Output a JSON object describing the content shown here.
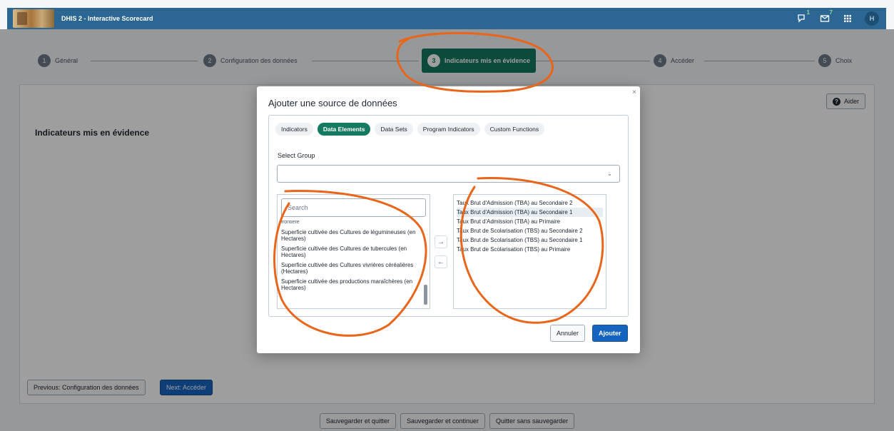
{
  "header": {
    "app_title": "DHIS 2 - Interactive Scorecard",
    "interpretations_badge": "1",
    "messages_badge": "7",
    "avatar_initial": "H"
  },
  "stepper": {
    "steps": [
      {
        "num": "1",
        "label": "Général"
      },
      {
        "num": "2",
        "label": "Configuration des données"
      },
      {
        "num": "3",
        "label": "Indicateurs mis en évidence"
      },
      {
        "num": "4",
        "label": "Accéder"
      },
      {
        "num": "5",
        "label": "Choix"
      }
    ],
    "active_step": 3
  },
  "main": {
    "heading": "Indicateurs mis en évidence",
    "help_label": "Aider",
    "prev_label": "Previous: Configuration des données",
    "next_label": "Next: Accéder"
  },
  "footer": {
    "save_quit": "Sauvegarder et quitter",
    "save_continue": "Sauvegarder et continuer",
    "quit_no_save": "Quitter sans sauvegarder"
  },
  "modal": {
    "close": "×",
    "title": "Ajouter une source de données",
    "tabs": [
      {
        "label": "Indicators",
        "active": false
      },
      {
        "label": "Data Elements",
        "active": true
      },
      {
        "label": "Data Sets",
        "active": false
      },
      {
        "label": "Program Indicators",
        "active": false
      },
      {
        "label": "Custom Functions",
        "active": false
      }
    ],
    "select_label": "Select Group",
    "select_value": "",
    "search_placeholder": "Search",
    "available": [
      "frontière",
      "Superficie cultivée des Cultures de légumineuses (en Hectares)",
      "Superficie cultivée des Cultures de tubercules (en Hectares)",
      "Superficie cultivée des Cultures vivrières céréalières (Hectares)",
      "Superficie cultivée des productions maraîchères (en Hectares)"
    ],
    "selected": [
      "Taux Brut d'Admission (TBA) au Secondaire 2",
      "Taux Brut d'Admission (TBA) au Secondaire 1",
      "Taux Brut d'Admission (TBA) au Primaire",
      "Taux Brut de Scolarisation (TBS) au Secondaire 2",
      "Taux Brut de Scolarisation (TBS) au Secondaire 1",
      "Taux Brut de Scolarisation (TBS) au Primaire"
    ],
    "highlighted_selected_index": 1,
    "transfer_right": "→",
    "transfer_left": "←",
    "cancel_label": "Annuler",
    "add_label": "Ajouter"
  },
  "colors": {
    "header_bg": "#2c6693",
    "active_green": "#147a60",
    "primary_blue": "#1565c0",
    "annotation_orange": "#e8651a"
  }
}
